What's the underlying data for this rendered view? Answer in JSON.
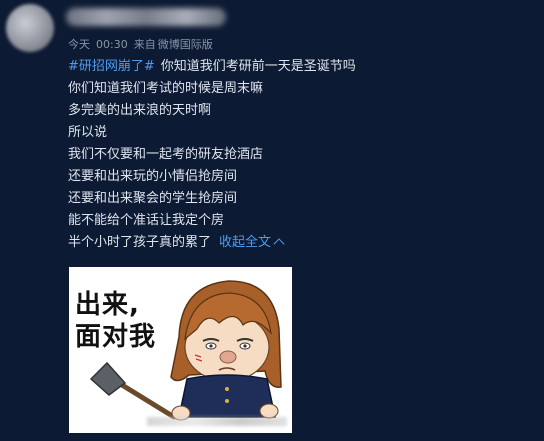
{
  "post": {
    "meta": {
      "date": "今天",
      "time": "00:30",
      "source_prefix": "来自",
      "source": "微博国际版"
    },
    "hashtag": "#研招网崩了#",
    "lines": [
      "你知道我们考研前一天是圣诞节吗",
      "你们知道我们考试的时候是周末嘛",
      "多完美的出来浪的天时啊",
      "所以说",
      "我们不仅要和一起考的研友抢酒店",
      "还要和出来玩的小情侣抢房间",
      "还要和出来聚会的学生抢房间",
      "能不能给个准话让我定个房",
      "半个小时了孩子真的累了"
    ],
    "collapse_label": "收起全文"
  },
  "meme": {
    "text_line1": "出来,",
    "text_line2": "面对我"
  },
  "colors": {
    "background": "#0d1a33",
    "link": "#4d9cf0",
    "text": "#dfe5ef"
  }
}
